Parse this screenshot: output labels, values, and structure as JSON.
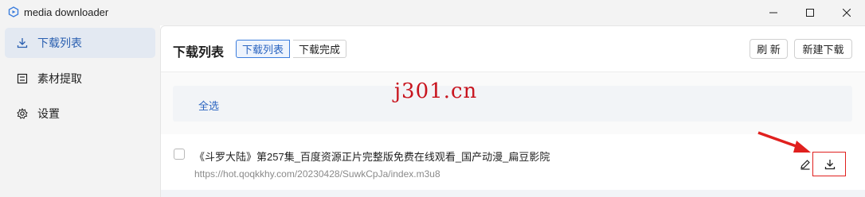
{
  "window": {
    "title": "media downloader"
  },
  "sidebar": {
    "items": [
      {
        "label": "下载列表",
        "icon": "download-icon",
        "active": true
      },
      {
        "label": "素材提取",
        "icon": "media-icon",
        "active": false
      },
      {
        "label": "设置",
        "icon": "gear-icon",
        "active": false
      }
    ]
  },
  "main": {
    "title": "下载列表",
    "tabs": [
      {
        "label": "下载列表",
        "selected": true
      },
      {
        "label": "下载完成",
        "selected": false
      }
    ],
    "refresh_label": "刷 新",
    "new_download_label": "新建下载",
    "select_all_label": "全选"
  },
  "watermark": "j301.cn",
  "list": {
    "items": [
      {
        "title": "《斗罗大陆》第257集_百度资源正片完整版免费在线观看_国产动漫_扁豆影院",
        "url": "https://hot.qoqkkhy.com/20230428/SuwkCpJa/index.m3u8",
        "checked": false
      }
    ]
  },
  "colors": {
    "accent": "#2a64c0",
    "annotation": "#e0201e"
  }
}
